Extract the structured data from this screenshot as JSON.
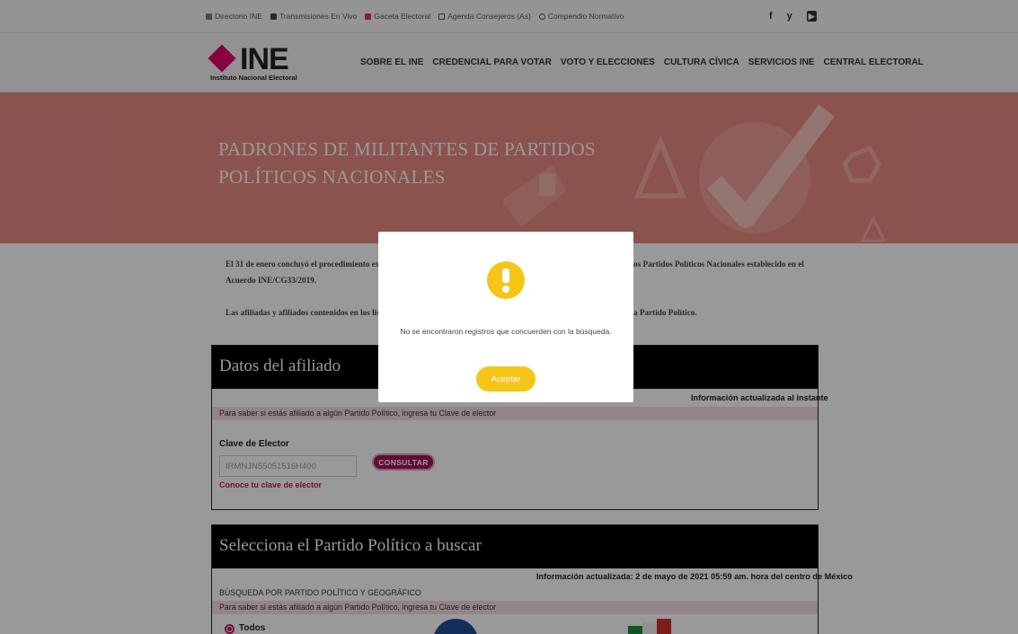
{
  "topbar": {
    "links": [
      {
        "label": "Directorio INE",
        "icon": "directory-icon"
      },
      {
        "label": "Transmisiones En Vivo",
        "icon": "video-camera-icon"
      },
      {
        "label": "Gaceta Electoral",
        "icon": "gazette-icon"
      },
      {
        "label": "Agenda Consejeros (As)",
        "icon": "calendar-icon"
      },
      {
        "label": "Compendio Normativo",
        "icon": "scales-icon"
      }
    ],
    "social": {
      "facebook": "f",
      "twitter": "y",
      "youtube": "▶"
    }
  },
  "logo": {
    "word": "INE",
    "subtitle": "Instituto Nacional Electoral"
  },
  "nav": {
    "items": [
      "SOBRE EL INE",
      "CREDENCIAL PARA VOTAR",
      "VOTO Y ELECCIONES",
      "CULTURA CÍVICA",
      "SERVICIOS INE",
      "CENTRAL ELECTORAL"
    ]
  },
  "hero": {
    "line1": "PADRONES DE MILITANTES DE PARTIDOS",
    "line2": "POLÍTICOS NACIONALES"
  },
  "intro": {
    "p1_left": "El 31 de enero concluyó el procedimiento ex",
    "p1_right": "os Partidos Políticos Nacionales establecido en el",
    "p1_line2": "Acuerdo INE/CG33/2019.",
    "p2_left": "Las afiliadas y afiliados contenidos en los lista",
    "p2_right": "a Partido Político."
  },
  "afiliado": {
    "title": "Datos del afiliado",
    "updated": "Información actualizada al instante",
    "hint": "Para saber si estás afiliado a algún Partido Político, ingresa tu Clave de elector",
    "field_label": "Clave de Elector",
    "field_value": "IRMNJN55051516H400",
    "button": "CONSULTAR",
    "link": "Conoce tu clave de elector"
  },
  "partido": {
    "title": "Selecciona el Partido Político a buscar",
    "updated": "Información actualizada: 2 de mayo de 2021 05:59 am. hora del centro de México",
    "search_label": "BÚSQUEDA POR PARTIDO POLÍTICO Y GEOGRÁFICO",
    "hint": "Para saber si estás afiliado a algún Partido Político, ingresa tu Clave de elector",
    "radio_todos": "Todos"
  },
  "modal": {
    "message": "No se encontraron registros que concuerden con la búsqueda.",
    "button": "Aceptar",
    "icon": "warning-icon"
  },
  "colors": {
    "brand": "#e0006e",
    "hero": "#e88b83",
    "consultar": "#a3155a",
    "warning": "#f5c518"
  }
}
